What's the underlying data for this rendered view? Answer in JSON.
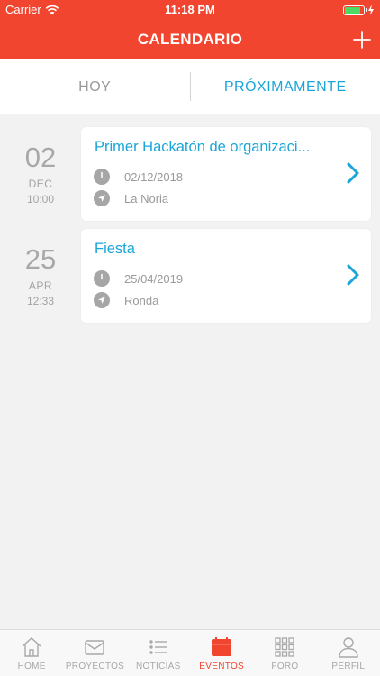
{
  "status_bar": {
    "carrier": "Carrier",
    "time": "11:18 PM",
    "battery_level": 0.85
  },
  "header": {
    "title": "CALENDARIO",
    "add_icon": "plus-icon"
  },
  "tabs": [
    {
      "label": "HOY",
      "active": false
    },
    {
      "label": "PRÓXIMAMENTE",
      "active": true
    }
  ],
  "events": [
    {
      "day": "02",
      "month": "DEC",
      "time": "10:00",
      "title": "Primer Hackatón de organizaci...",
      "date": "02/12/2018",
      "location": "La Noria"
    },
    {
      "day": "25",
      "month": "APR",
      "time": "12:33",
      "title": "Fiesta",
      "date": "25/04/2019",
      "location": "Ronda"
    }
  ],
  "tabbar": [
    {
      "label": "HOME",
      "icon": "home-icon",
      "active": false
    },
    {
      "label": "PROYECTOS",
      "icon": "inbox-icon",
      "active": false
    },
    {
      "label": "NOTICIAS",
      "icon": "list-icon",
      "active": false
    },
    {
      "label": "EVENTOS",
      "icon": "calendar-icon",
      "active": true
    },
    {
      "label": "FORO",
      "icon": "grid-icon",
      "active": false
    },
    {
      "label": "PERFIL",
      "icon": "person-icon",
      "active": false
    }
  ],
  "colors": {
    "brand": "#f2452f",
    "accent": "#1aa6d8",
    "muted": "#9a9a9a"
  }
}
